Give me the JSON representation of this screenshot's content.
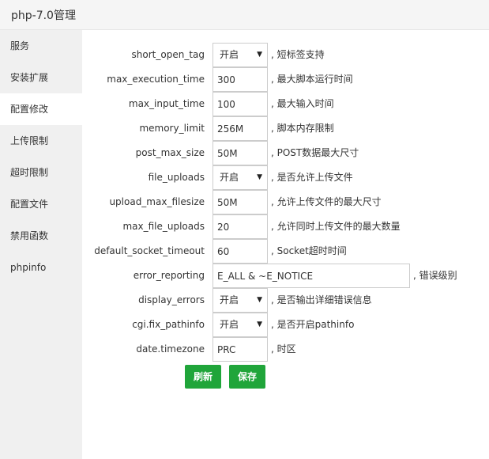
{
  "window": {
    "title": "php-7.0管理"
  },
  "sidebar": {
    "items": [
      {
        "label": "服务"
      },
      {
        "label": "安装扩展"
      },
      {
        "label": "配置修改"
      },
      {
        "label": "上传限制"
      },
      {
        "label": "超时限制"
      },
      {
        "label": "配置文件"
      },
      {
        "label": "禁用函数"
      },
      {
        "label": "phpinfo"
      }
    ],
    "active_index": 2
  },
  "config": {
    "short_open_tag": {
      "label": "short_open_tag",
      "value": "开启",
      "hint": ", 短标签支持"
    },
    "max_execution_time": {
      "label": "max_execution_time",
      "value": "300",
      "hint": ", 最大脚本运行时间"
    },
    "max_input_time": {
      "label": "max_input_time",
      "value": "100",
      "hint": ", 最大输入时间"
    },
    "memory_limit": {
      "label": "memory_limit",
      "value": "256M",
      "hint": ", 脚本内存限制"
    },
    "post_max_size": {
      "label": "post_max_size",
      "value": "50M",
      "hint": ", POST数据最大尺寸"
    },
    "file_uploads": {
      "label": "file_uploads",
      "value": "开启",
      "hint": ", 是否允许上传文件"
    },
    "upload_max_filesize": {
      "label": "upload_max_filesize",
      "value": "50M",
      "hint": ", 允许上传文件的最大尺寸"
    },
    "max_file_uploads": {
      "label": "max_file_uploads",
      "value": "20",
      "hint": ", 允许同时上传文件的最大数量"
    },
    "default_socket_timeout": {
      "label": "default_socket_timeout",
      "value": "60",
      "hint": ", Socket超时时间"
    },
    "error_reporting": {
      "label": "error_reporting",
      "value": "E_ALL & ~E_NOTICE",
      "hint": ", 错误级别"
    },
    "display_errors": {
      "label": "display_errors",
      "value": "开启",
      "hint": ", 是否输出详细错误信息"
    },
    "cgi_fix_pathinfo": {
      "label": "cgi.fix_pathinfo",
      "value": "开启",
      "hint": ", 是否开启pathinfo"
    },
    "date_timezone": {
      "label": "date.timezone",
      "value": "PRC",
      "hint": ", 时区"
    }
  },
  "actions": {
    "refresh_label": "刷新",
    "save_label": "保存"
  },
  "colors": {
    "primary_button": "#20a53a",
    "sidebar_bg": "#f0f0f0",
    "titlebar_bg": "#f5f5f5"
  }
}
